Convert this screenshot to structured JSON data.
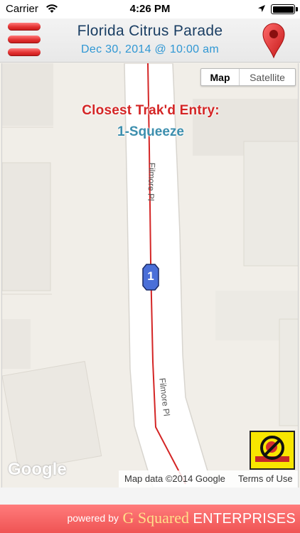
{
  "status_bar": {
    "carrier": "Carrier",
    "time": "4:26 PM",
    "icons": [
      "wifi-icon",
      "location-arrow-icon",
      "battery-icon"
    ]
  },
  "header": {
    "title": "Florida Citrus Parade",
    "subtitle": "Dec 30, 2014 @ 10:00 am",
    "menu_icon": "hamburger-menu-icon",
    "pin_icon": "map-pin-icon",
    "title_color": "#1a3e63",
    "subtitle_color": "#2f97d4",
    "accent_red": "#e23030"
  },
  "map": {
    "toggle": {
      "map_label": "Map",
      "satellite_label": "Satellite",
      "selected": "Map"
    },
    "closest_label": "Closest Trak'd Entry:",
    "closest_value": "1-Squeeze",
    "streets": [
      "Filmore Pl",
      "Filmore Pl"
    ],
    "marker_label": "1",
    "marker_color": "#4a6fd8",
    "route_color": "#d42525",
    "no_sign_icon": "no-entry-sign-icon",
    "logo": "Google",
    "attribution": "Map data ©2014 Google",
    "terms": "Terms of Use"
  },
  "footer": {
    "powered_by": "powered by",
    "brand_g": "G",
    "brand_squared": "Squared",
    "brand_enterprises": "ENTERPRISES",
    "background": "#ef5454"
  }
}
